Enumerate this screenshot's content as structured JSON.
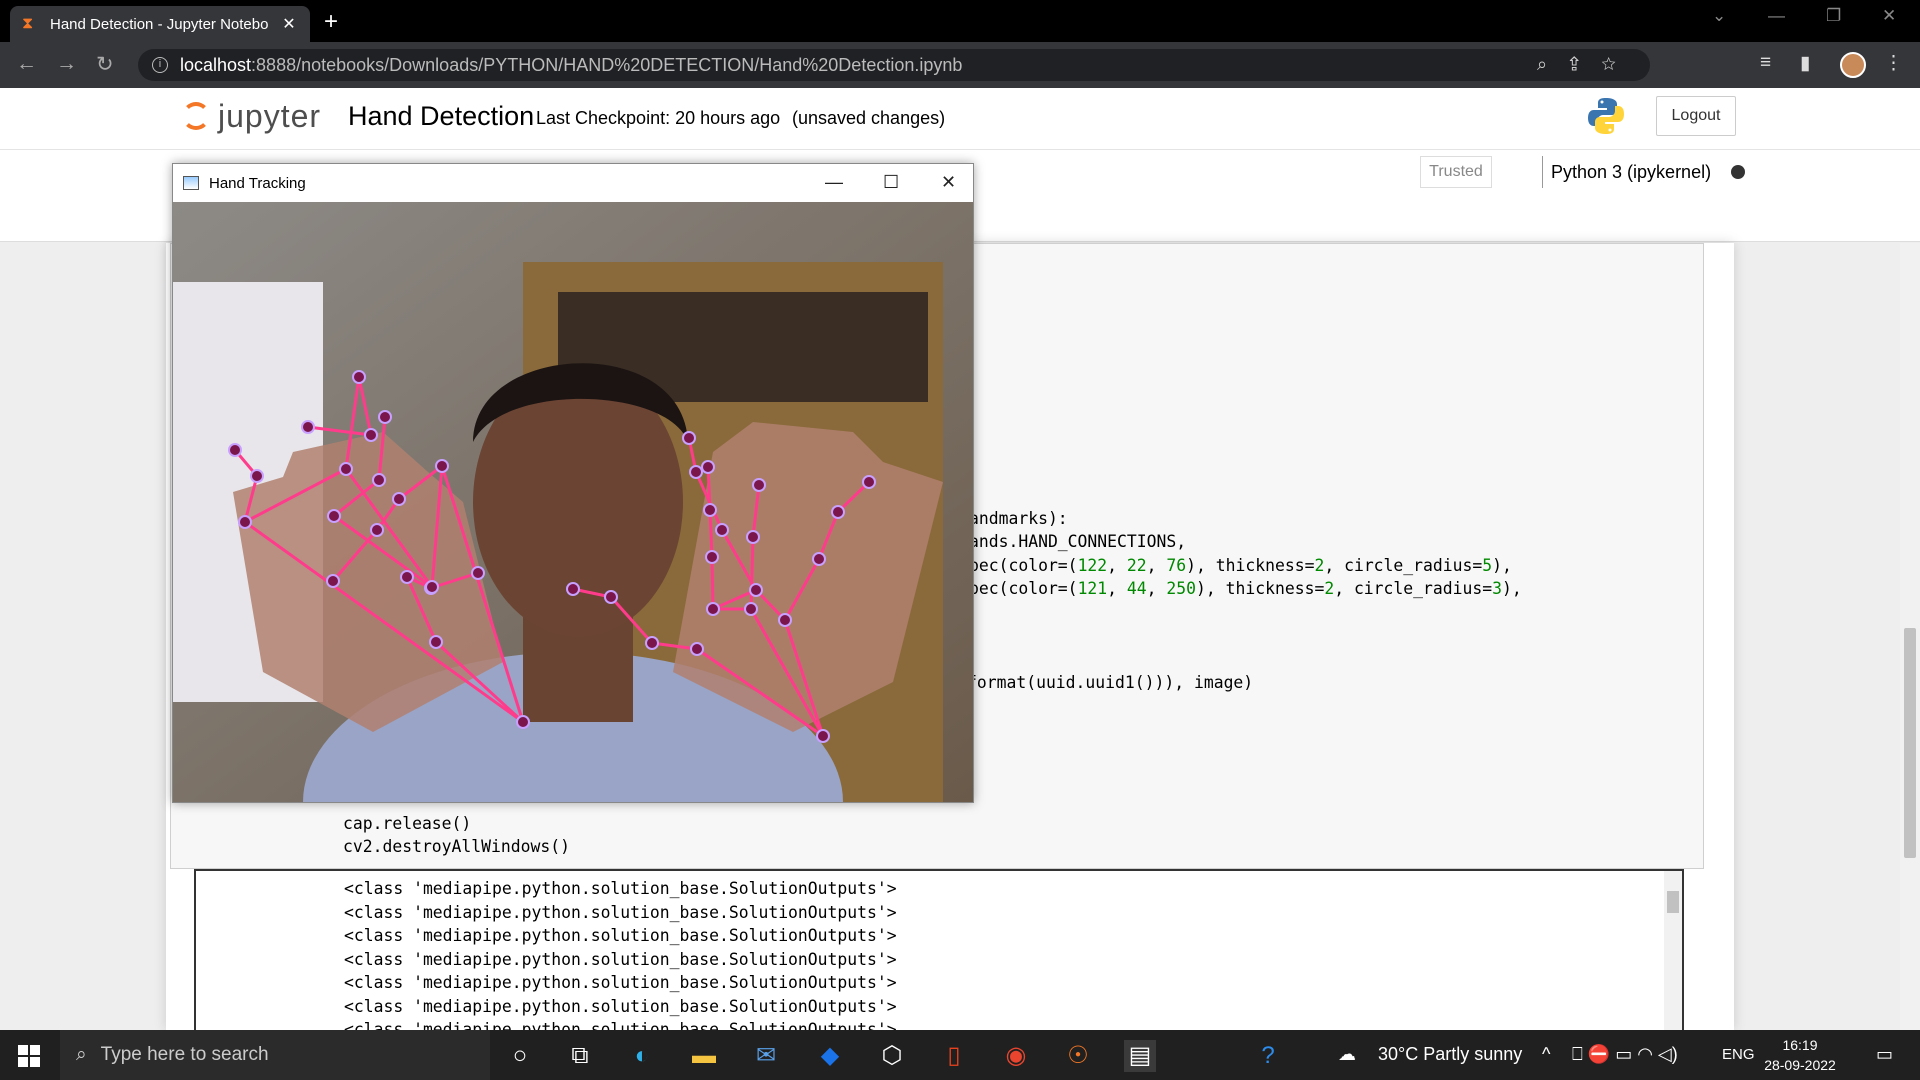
{
  "browser": {
    "tab_title": "Hand Detection - Jupyter Notebo",
    "url_host": "localhost",
    "url_path": ":8888/notebooks/Downloads/PYTHON/HAND%20DETECTION/Hand%20Detection.ipynb"
  },
  "jupyter": {
    "logo_text": "jupyter",
    "notebook_title": "Hand Detection",
    "checkpoint": "Last Checkpoint: 20 hours ago",
    "unsaved": "(unsaved changes)",
    "logout_label": "Logout",
    "trusted_label": "Trusted",
    "kernel_label": "Python 3 (ipykernel)"
  },
  "cv_window": {
    "title": "Hand Tracking"
  },
  "code_lines": [
    {
      "text": "andmarks):"
    },
    {
      "text": "ands.HAND_CONNECTIONS,"
    },
    {
      "pre": "pec(color=(",
      "nums": [
        "122",
        "22",
        "76"
      ],
      "mid": "), thickness=",
      "n2": "2",
      "mid2": ", circle_radius=",
      "n3": "5",
      "post": "),"
    },
    {
      "pre": "pec(color=(",
      "nums": [
        "121",
        "44",
        "250"
      ],
      "mid": "), thickness=",
      "n2": "2",
      "mid2": ", circle_radius=",
      "n3": "3",
      "post": "),"
    },
    {
      "text": "format(uuid.uuid1())), image)"
    },
    {
      "text": "cap.release()"
    },
    {
      "text": "cv2.destroyAllWindows()"
    }
  ],
  "output_lines": [
    "<class 'mediapipe.python.solution_base.SolutionOutputs'>",
    "<class 'mediapipe.python.solution_base.SolutionOutputs'>",
    "<class 'mediapipe.python.solution_base.SolutionOutputs'>",
    "<class 'mediapipe.python.solution_base.SolutionOutputs'>",
    "<class 'mediapipe.python.solution_base.SolutionOutputs'>",
    "<class 'mediapipe.python.solution_base.SolutionOutputs'>",
    "<class 'mediapipe.python.solution_base.SolutionOutputs'>"
  ],
  "taskbar": {
    "search_placeholder": "Type here to search",
    "weather": "30°C  Partly sunny",
    "lang": "ENG",
    "time": "16:19",
    "date": "28-09-2022"
  },
  "colors": {
    "jupyter_orange": "#f37726",
    "landmark": "#7a164c",
    "connection": "#ff3c8c",
    "tab_bg": "#35363a"
  }
}
